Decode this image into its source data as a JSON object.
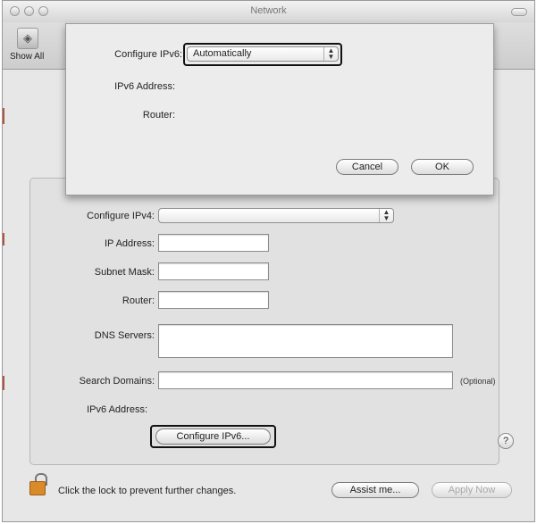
{
  "window": {
    "title": "Network"
  },
  "toolbar": {
    "show_all_label": "Show All"
  },
  "sheet": {
    "configure_ipv6_label": "Configure IPv6:",
    "configure_ipv6_value": "Automatically",
    "ipv6_address_label": "IPv6 Address:",
    "router_label": "Router:",
    "cancel_label": "Cancel",
    "ok_label": "OK"
  },
  "form": {
    "configure_ipv4_label": "Configure IPv4:",
    "configure_ipv4_value": "",
    "ip_address_label": "IP Address:",
    "ip_address_value": "",
    "subnet_mask_label": "Subnet Mask:",
    "subnet_mask_value": "",
    "router_label": "Router:",
    "router_value": "",
    "dns_servers_label": "DNS Servers:",
    "dns_servers_value": "",
    "search_domains_label": "Search Domains:",
    "search_domains_value": "",
    "optional_label": "(Optional)",
    "ipv6_address_label": "IPv6 Address:",
    "configure_ipv6_button": "Configure IPv6...",
    "help_label": "?"
  },
  "footer": {
    "lock_text": "Click the lock to prevent further changes.",
    "assist_label": "Assist me...",
    "apply_label": "Apply Now"
  },
  "icons": {
    "show_all": "show-all-icon",
    "lock": "lock-icon",
    "help": "help-icon"
  }
}
